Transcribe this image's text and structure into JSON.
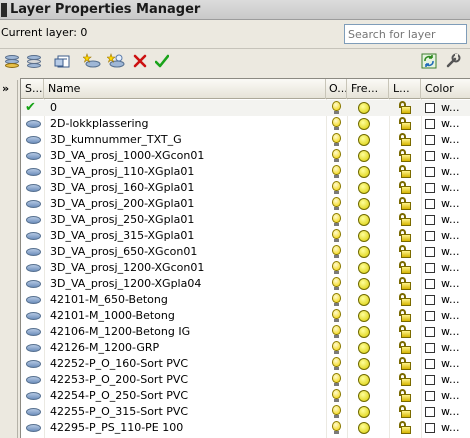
{
  "window": {
    "title": "Layer Properties Manager"
  },
  "status": {
    "current_layer": "Current layer: 0"
  },
  "search": {
    "placeholder": "Search for layer"
  },
  "toolbar": {
    "left_buttons": [
      {
        "icon": "new-property-filter-icon"
      },
      {
        "icon": "new-group-filter-icon"
      },
      {
        "icon": "layer-states-manager-icon"
      },
      {
        "icon": "new-layer-icon"
      },
      {
        "icon": "new-layer-vp-frozen-icon"
      },
      {
        "icon": "delete-layer-icon",
        "color": "#cc1111"
      },
      {
        "icon": "set-current-icon",
        "color": "#1aa31a"
      }
    ],
    "right_buttons": [
      {
        "icon": "refresh-icon"
      },
      {
        "icon": "settings-icon"
      }
    ]
  },
  "filter_panel": {
    "toggle": "»"
  },
  "columns": [
    "S...",
    "Name",
    "O...",
    "Fre...",
    "L...",
    "Color"
  ],
  "rows": [
    {
      "name": "0",
      "current": true,
      "color": "w..."
    },
    {
      "name": "2D-lokkplassering",
      "current": false,
      "color": "w..."
    },
    {
      "name": "3D_kumnummer_TXT_G",
      "current": false,
      "color": "w..."
    },
    {
      "name": "3D_VA_prosj_1000-XGcon01",
      "current": false,
      "color": "w..."
    },
    {
      "name": "3D_VA_prosj_110-XGpla01",
      "current": false,
      "color": "w..."
    },
    {
      "name": "3D_VA_prosj_160-XGpla01",
      "current": false,
      "color": "w..."
    },
    {
      "name": "3D_VA_prosj_200-XGpla01",
      "current": false,
      "color": "w..."
    },
    {
      "name": "3D_VA_prosj_250-XGpla01",
      "current": false,
      "color": "w..."
    },
    {
      "name": "3D_VA_prosj_315-XGpla01",
      "current": false,
      "color": "w..."
    },
    {
      "name": "3D_VA_prosj_650-XGcon01",
      "current": false,
      "color": "w..."
    },
    {
      "name": "3D_VA_prosj_1200-XGcon01",
      "current": false,
      "color": "w..."
    },
    {
      "name": "3D_VA_prosj_1200-XGpla04",
      "current": false,
      "color": "w..."
    },
    {
      "name": "42101-M_650-Betong",
      "current": false,
      "color": "w..."
    },
    {
      "name": "42101-M_1000-Betong",
      "current": false,
      "color": "w..."
    },
    {
      "name": "42106-M_1200-Betong IG",
      "current": false,
      "color": "w..."
    },
    {
      "name": "42126-M_1200-GRP",
      "current": false,
      "color": "w..."
    },
    {
      "name": "42252-P_O_160-Sort PVC",
      "current": false,
      "color": "w..."
    },
    {
      "name": "42253-P_O_200-Sort PVC",
      "current": false,
      "color": "w..."
    },
    {
      "name": "42254-P_O_250-Sort PVC",
      "current": false,
      "color": "w..."
    },
    {
      "name": "42255-P_O_315-Sort PVC",
      "current": false,
      "color": "w..."
    },
    {
      "name": "42295-P_PS_110-PE 100",
      "current": false,
      "color": "w..."
    }
  ]
}
